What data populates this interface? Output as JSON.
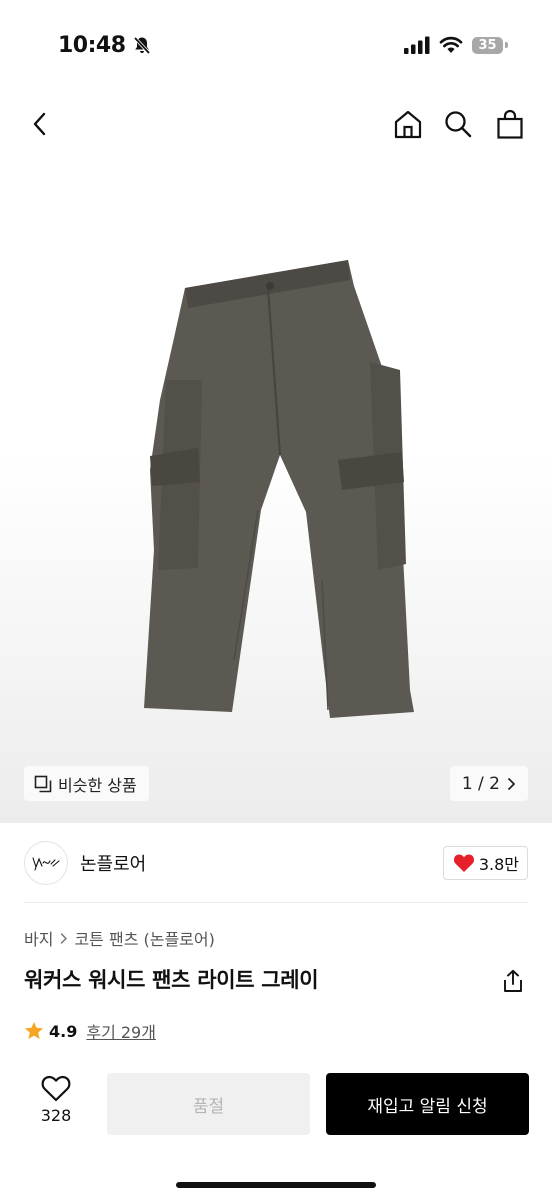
{
  "status_bar": {
    "time": "10:48",
    "battery": "35"
  },
  "nav": {
    "back_icon": "chevron-left-icon",
    "home_icon": "home-icon",
    "search_icon": "search-icon",
    "bag_icon": "shopping-bag-icon"
  },
  "hero": {
    "similar_label": "비슷한 상품",
    "page_indicator": "1 / 2",
    "page_current": 1,
    "page_total": 2
  },
  "brand": {
    "name": "논플로어",
    "likes": "3.8만",
    "like_color": "#e8202c"
  },
  "breadcrumb": {
    "level1": "바지",
    "level2": "코튼 팬츠 (논플로어)"
  },
  "product": {
    "title": "워커스 워시드 팬츠 라이트 그레이",
    "rating": "4.9",
    "review_label": "후기 29개",
    "star_color": "#f5a623"
  },
  "actions": {
    "wish_count": "328",
    "soldout_label": "품절",
    "restock_label": "재입고 알림 신청"
  }
}
